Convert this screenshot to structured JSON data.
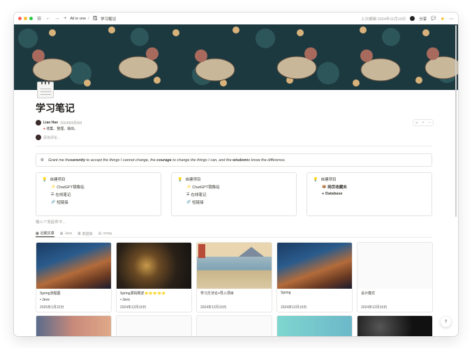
{
  "window": {
    "traffic_lights": [
      "#ff5f57",
      "#febc2e",
      "#28c840"
    ],
    "breadcrumb_workspace": "All in one",
    "breadcrumb_sep": "/",
    "breadcrumb_page": "学习笔记",
    "last_edited": "上次编辑 2024年11月13日",
    "share_label": "分享",
    "star_color": "#f5b400"
  },
  "page": {
    "title": "学习笔记",
    "author": "Liao Hao",
    "author_date": "2024年8月8日",
    "subtitle": "收集、整理、输出。",
    "comment_placeholder": "添加评论..."
  },
  "quote": {
    "part1": "Grant me the ",
    "w1": "serenity",
    "part2": " to accept the things I cannot change, the ",
    "w2": "courage",
    "part3": " to change the things I can, and the ",
    "w3": "wisdom",
    "part4": " to know the difference."
  },
  "cards": [
    {
      "header": "自建项目",
      "items": [
        {
          "icon": "✨",
          "label": "ChatGPT镜像站"
        },
        {
          "icon": "☰",
          "label": "在线笔记"
        },
        {
          "icon": "🔗",
          "label": "短链接"
        }
      ]
    },
    {
      "header": "自建项目",
      "items": [
        {
          "icon": "✨",
          "label": "ChatGPT镜像站"
        },
        {
          "icon": "☰",
          "label": "在线笔记"
        },
        {
          "icon": "🔗",
          "label": "短链接"
        }
      ]
    },
    {
      "header": "自建项目",
      "items": [
        {
          "icon": "📦",
          "label": "网页收藏夹"
        },
        {
          "icon": "●",
          "label": "Database"
        }
      ]
    }
  ],
  "command_placeholder": "输入\"/\"发起命令...",
  "tabs": [
    {
      "icon": "▦",
      "label": "近期文章"
    },
    {
      "icon": "▦",
      "label": "Java"
    },
    {
      "icon": "▦",
      "label": "数据库"
    },
    {
      "icon": "▤",
      "label": "untag"
    }
  ],
  "gallery": [
    {
      "title": "Spring流程图",
      "tag": "Java",
      "date": "2025年1月22日"
    },
    {
      "title": "Spring源码概述⭐⭐⭐⭐⭐",
      "tag": "Java",
      "date": "2024年12月10日"
    },
    {
      "title": "学习方法论+导入项目",
      "tag": "",
      "date": "2024年12月10日"
    },
    {
      "title": "Spring",
      "tag": "",
      "date": "2024年12月10日"
    },
    {
      "title": "设计模式",
      "tag": "",
      "date": "2024年12月10日"
    }
  ],
  "help_label": "?"
}
